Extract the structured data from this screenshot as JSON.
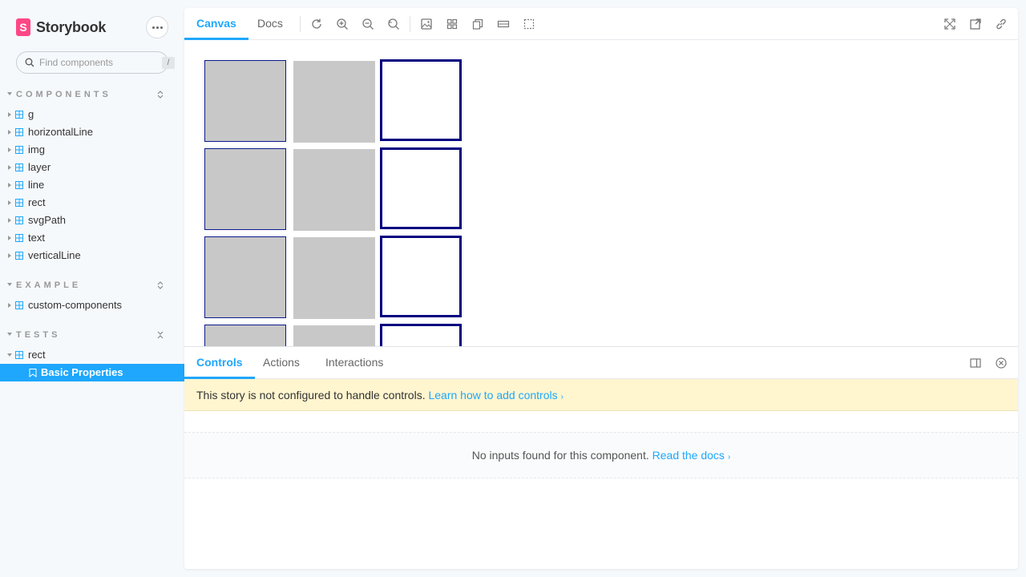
{
  "brand": {
    "name": "Storybook",
    "logo_letter": "S",
    "accent": "#ff4785"
  },
  "search": {
    "placeholder": "Find components",
    "shortcut": "/"
  },
  "sections": [
    {
      "title": "COMPONENTS",
      "items": [
        "g",
        "horizontalLine",
        "img",
        "layer",
        "line",
        "rect",
        "svgPath",
        "text",
        "verticalLine"
      ]
    },
    {
      "title": "EXAMPLE",
      "items": [
        "custom-components"
      ]
    },
    {
      "title": "TESTS",
      "items": [
        "rect"
      ],
      "story": "Basic Properties"
    }
  ],
  "toolbar": {
    "tabs": [
      "Canvas",
      "Docs"
    ],
    "active_tab": "Canvas",
    "tools": [
      "reload-icon",
      "zoom-in-icon",
      "zoom-out-icon",
      "zoom-reset-icon",
      "background-icon",
      "grid-icon",
      "viewport-icon",
      "measure-icon",
      "outline-icon"
    ],
    "right_tools": [
      "fullscreen-icon",
      "open-new-tab-icon",
      "copy-link-icon"
    ]
  },
  "canvas": {
    "rows": 4,
    "columns": [
      "gray-thin-border",
      "gray",
      "white-thick-border"
    ],
    "colors": {
      "gray": "#c8c8c8",
      "border": "#000080"
    }
  },
  "addons": {
    "tabs": [
      "Controls",
      "Actions",
      "Interactions"
    ],
    "active_tab": "Controls",
    "notice_text": "This story is not configured to handle controls.",
    "notice_link": "Learn how to add controls",
    "empty_text": "No inputs found for this component.",
    "empty_link": "Read the docs"
  },
  "accent": "#1ea7fd"
}
